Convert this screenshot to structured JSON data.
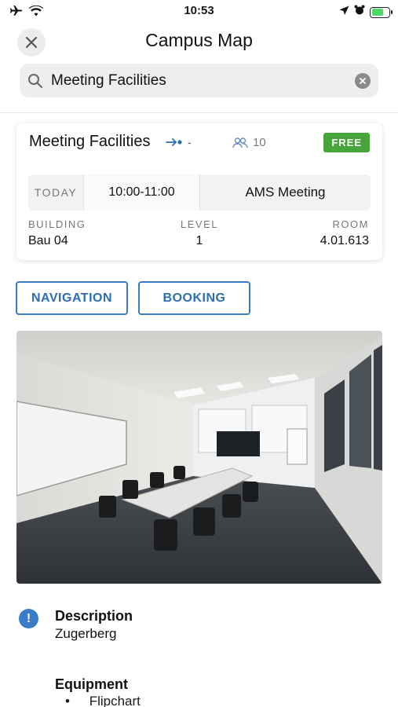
{
  "status_bar": {
    "time": "10:53",
    "battery_level": 0.7,
    "battery_color": "#4cd964"
  },
  "header": {
    "title": "Campus Map",
    "close_icon": "close-icon"
  },
  "search": {
    "value": "Meeting Facilities",
    "icon": "search-icon",
    "clear_icon": "clear-icon"
  },
  "room": {
    "name": "Meeting Facilities",
    "route_icon": "route-arrow-icon",
    "route_text": "-",
    "capacity_icon": "people-icon",
    "capacity": "10",
    "status": "FREE",
    "status_color": "#47a53b",
    "booking": {
      "day": "TODAY",
      "time": "10:00-11:00",
      "event": "AMS Meeting"
    },
    "building_label": "BUILDING",
    "building": "Bau 04",
    "level_label": "LEVEL",
    "level": "1",
    "room_label": "ROOM",
    "room_number": "4.01.613"
  },
  "actions": {
    "navigation": "NAVIGATION",
    "booking": "BOOKING",
    "accent": "#3a7bc8"
  },
  "details": {
    "info_icon": "info-icon",
    "description_heading": "Description",
    "description": "Zugerberg",
    "equipment_heading": "Equipment",
    "equipment": [
      "Flipchart"
    ]
  }
}
